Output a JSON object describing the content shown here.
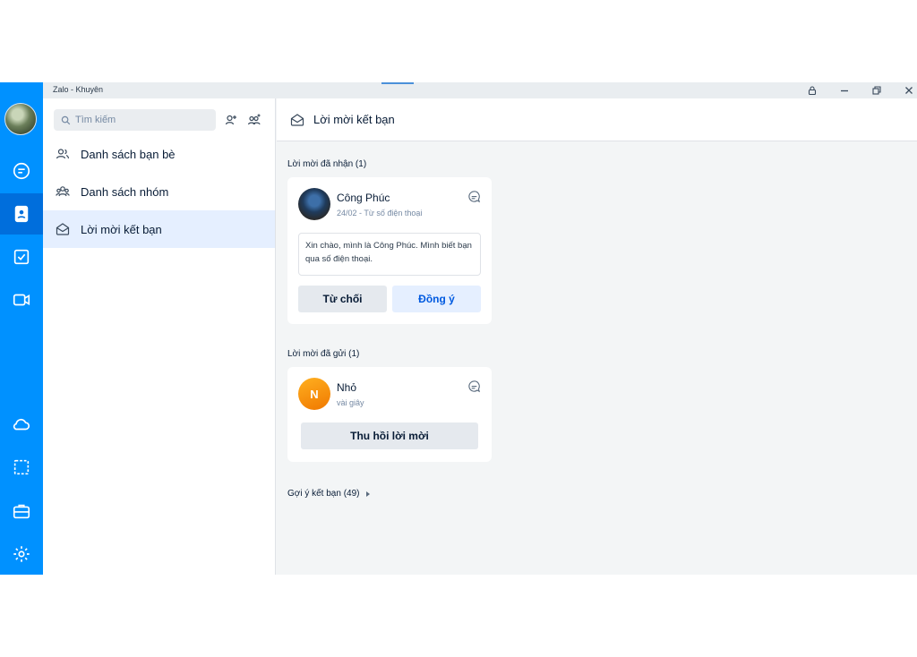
{
  "window": {
    "title": "Zalo - Khuyên"
  },
  "colors": {
    "rail": "#0091ff",
    "rail_active": "#006edc",
    "accent_blue": "#005ae0",
    "sent_avatar": "#f08c00"
  },
  "sidebar_rail": {
    "items": [
      {
        "icon": "chat-icon"
      },
      {
        "icon": "contacts-icon",
        "active": true
      },
      {
        "icon": "todo-icon"
      },
      {
        "icon": "video-icon"
      },
      {
        "icon": "cloud-icon"
      },
      {
        "icon": "screenshot-icon"
      },
      {
        "icon": "toolbox-icon"
      },
      {
        "icon": "settings-icon"
      }
    ]
  },
  "contacts_panel": {
    "search_placeholder": "Tìm kiếm",
    "nav": [
      {
        "label": "Danh sách bạn bè",
        "icon": "friends-icon"
      },
      {
        "label": "Danh sách nhóm",
        "icon": "groups-icon"
      },
      {
        "label": "Lời mời kết bạn",
        "icon": "envelope-icon",
        "active": true
      }
    ]
  },
  "main": {
    "header_title": "Lời mời kết bạn",
    "received": {
      "label": "Lời mời đã nhận (1)",
      "name": "Công Phúc",
      "meta": "24/02 - Từ số điện thoại",
      "message": "Xin chào, mình là Công Phúc. Mình biết bạn qua số điện thoại.",
      "decline_label": "Từ chối",
      "accept_label": "Đồng ý"
    },
    "sent": {
      "label": "Lời mời đã gửi (1)",
      "avatar_initial": "N",
      "name": "Nhỏ",
      "meta": "vài giây",
      "recall_label": "Thu hồi lời mời"
    },
    "suggestions_label": "Gợi ý kết bạn (49)"
  }
}
